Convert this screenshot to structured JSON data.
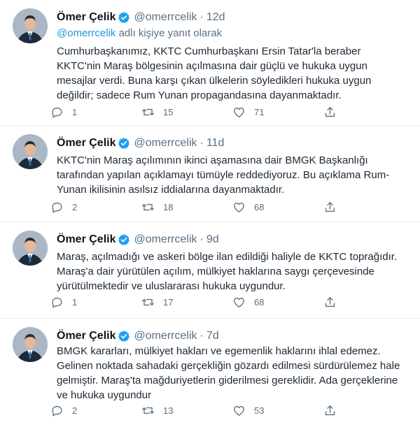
{
  "colors": {
    "link": "#1b95e0",
    "verified": "#1da1f2",
    "muted": "#5b7083",
    "divider": "#e6ecf0"
  },
  "tweets": [
    {
      "name": "Ömer Çelik",
      "handle": "@omerrcelik",
      "dot": "·",
      "time": "12d",
      "reply_mention": "@omerrcelik",
      "reply_suffix": " adlı kişiye yanıt olarak",
      "text": "Cumhurbaşkanımız, KKTC Cumhurbaşkanı Ersin Tatar'la beraber KKTC'nin Maraş bölgesinin açılmasına dair güçlü ve hukuka uygun mesajlar verdi. Buna karşı çıkan ülkelerin söyledikleri hukuka uygun değildir; sadece Rum Yunan propagandasına dayanmaktadır.",
      "replies": "1",
      "retweets": "15",
      "likes": "71"
    },
    {
      "name": "Ömer Çelik",
      "handle": "@omerrcelik",
      "dot": "·",
      "time": "11d",
      "text": "KKTC'nin Maraş açılımının ikinci aşamasına dair BMGK Başkanlığı tarafından yapılan açıklamayı tümüyle reddediyoruz. Bu açıklama Rum-Yunan ikilisinin asılsız iddialarına dayanmaktadır.",
      "replies": "2",
      "retweets": "18",
      "likes": "68"
    },
    {
      "name": "Ömer Çelik",
      "handle": "@omerrcelik",
      "dot": "·",
      "time": "9d",
      "text": "Maraş, açılmadığı ve askeri bölge ilan edildiği haliyle de KKTC toprağıdır. Maraş'a dair yürütülen açılım, mülkiyet haklarına saygı çerçevesinde yürütülmektedir ve uluslararası hukuka uygundur.",
      "replies": "1",
      "retweets": "17",
      "likes": "68"
    },
    {
      "name": "Ömer Çelik",
      "handle": "@omerrcelik",
      "dot": "·",
      "time": "7d",
      "text": "BMGK kararları, mülkiyet hakları ve egemenlik haklarını ihlal edemez. Gelinen noktada sahadaki gerçekliğin gözardı edilmesi sürdürülemez hale gelmiştir. Maraş'ta mağduriyetlerin giderilmesi gereklidir. Ada gerçeklerine ve hukuka uygundur",
      "replies": "2",
      "retweets": "13",
      "likes": "53"
    }
  ]
}
